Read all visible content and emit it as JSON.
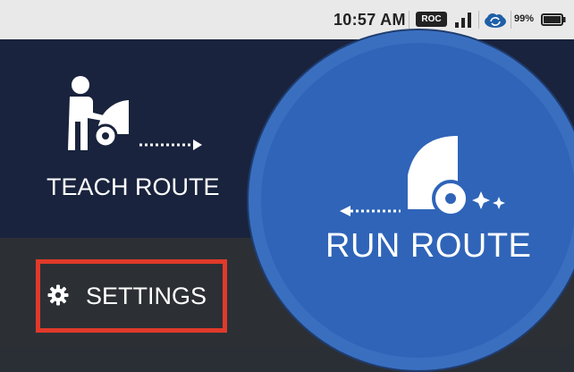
{
  "status_bar": {
    "time": "10:57 AM",
    "roc_badge": "ROC",
    "battery_percent": "99%",
    "icons": [
      "signal-icon",
      "cloud-sync-icon",
      "battery-icon"
    ]
  },
  "tiles": {
    "teach_route_label": "TEACH ROUTE",
    "run_route_label": "RUN ROUTE",
    "settings_label": "SETTINGS"
  },
  "colors": {
    "teach_bg": "#19233d",
    "run_circle": "#2f64b8",
    "settings_bg": "#2c3035",
    "highlight": "#e03a2a",
    "statusbar_bg": "#e9e9e9"
  }
}
